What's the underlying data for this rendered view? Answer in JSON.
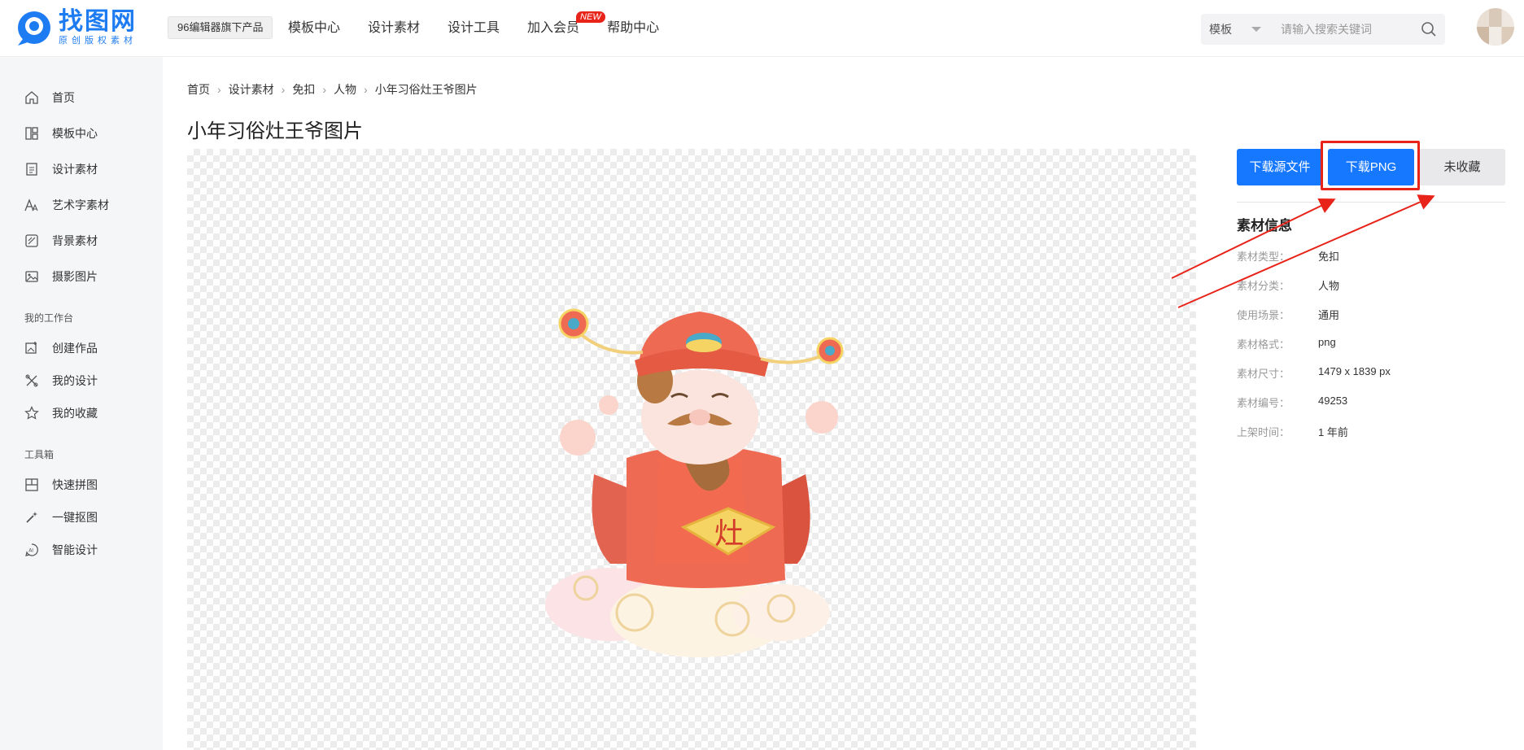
{
  "header": {
    "logo_title": "找图网",
    "logo_sub": "原创版权素材",
    "product_badge": "96编辑器旗下产品",
    "nav": [
      "模板中心",
      "设计素材",
      "设计工具",
      "加入会员",
      "帮助中心"
    ],
    "new_badge": "NEW",
    "search_type": "模板",
    "search_placeholder": "请输入搜索关键词"
  },
  "sidebar": {
    "items_top": [
      "首页",
      "模板中心",
      "设计素材",
      "艺术字素材",
      "背景素材",
      "摄影图片"
    ],
    "group_workspace": "我的工作台",
    "items_workspace": [
      "创建作品",
      "我的设计",
      "我的收藏"
    ],
    "group_tools": "工具箱",
    "items_tools": [
      "快速拼图",
      "一键抠图",
      "智能设计"
    ]
  },
  "breadcrumb": [
    "首页",
    "设计素材",
    "免扣",
    "人物",
    "小年习俗灶王爷图片"
  ],
  "page_title": "小年习俗灶王爷图片",
  "preview": {
    "badge_char": "灶"
  },
  "actions": {
    "download_source": "下载源文件",
    "download_png": "下载PNG",
    "favorite": "未收藏"
  },
  "info": {
    "title": "素材信息",
    "rows": [
      {
        "key": "素材类型：",
        "value": "免扣"
      },
      {
        "key": "素材分类：",
        "value": "人物"
      },
      {
        "key": "使用场景：",
        "value": "通用"
      },
      {
        "key": "素材格式：",
        "value": "png"
      },
      {
        "key": "素材尺寸：",
        "value": "1479 x 1839 px"
      },
      {
        "key": "素材编号：",
        "value": "49253"
      },
      {
        "key": "上架时间：",
        "value": "1 年前"
      }
    ]
  },
  "colors": {
    "brand": "#1e7cf2",
    "button": "#1677ff",
    "annotation": "#e8241a"
  }
}
